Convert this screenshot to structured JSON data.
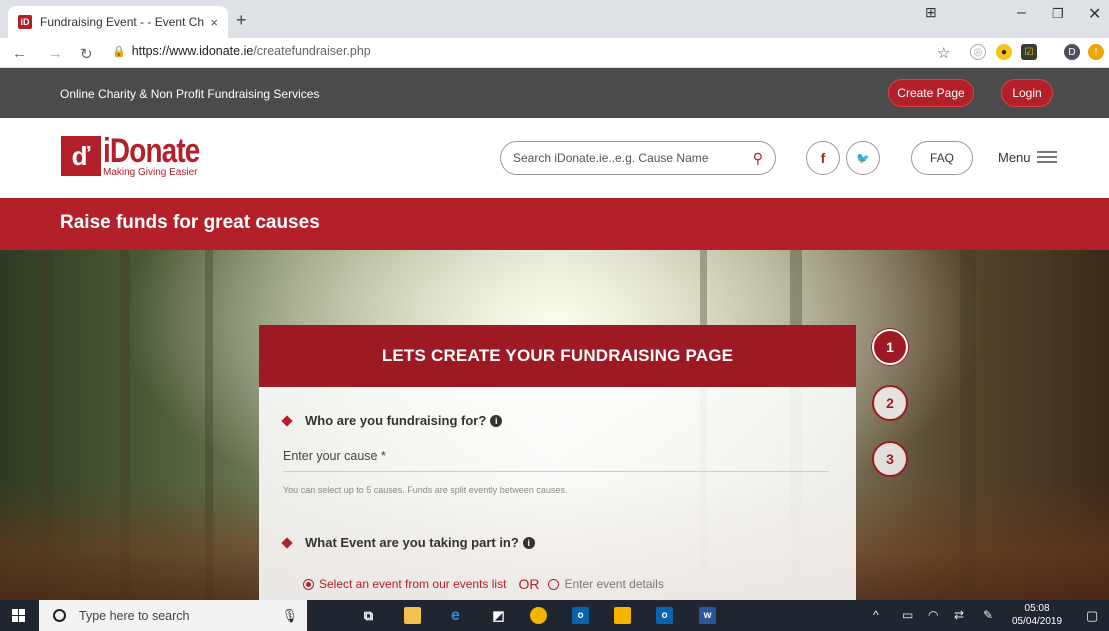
{
  "browser": {
    "tab_title": "Fundraising Event - - Event Char",
    "tab_favicon": "iD",
    "tab_close": "×",
    "new_tab": "+",
    "url_host": "https://www.idonate.ie",
    "url_path": "/createfundraiser.php",
    "profile_initial": "D"
  },
  "site": {
    "tagline": "Online Charity & Non Profit Fundraising Services",
    "create_page_label": "Create Page",
    "login_label": "Login",
    "brand": "iDonate",
    "slogan": "Making Giving Easier",
    "search_placeholder": "Search iDonate.ie..e.g. Cause Name",
    "facebook_glyph": "f",
    "twitter_glyph": "🐦",
    "faq_label": "FAQ",
    "menu_label": "Menu",
    "banner_title": "Raise funds for great causes"
  },
  "form": {
    "heading": "LETS CREATE YOUR FUNDRAISING PAGE",
    "q1": "Who are you fundraising for?",
    "cause_placeholder": "Enter your cause *",
    "cause_hint": "You can select up to 5 causes. Funds are split evently between causes.",
    "q2": "What Event are you taking part in?",
    "option_select": "Select an event from our events list",
    "or_label": "OR",
    "option_enter": "Enter event details",
    "steps": [
      "1",
      "2",
      "3"
    ]
  },
  "taskbar": {
    "search_placeholder": "Type here to search",
    "time": "05:08",
    "date": "05/04/2019"
  },
  "colors": {
    "brand_red": "#b3202a",
    "dark_strip": "#4b4b4b",
    "taskbar": "#1f2630"
  }
}
